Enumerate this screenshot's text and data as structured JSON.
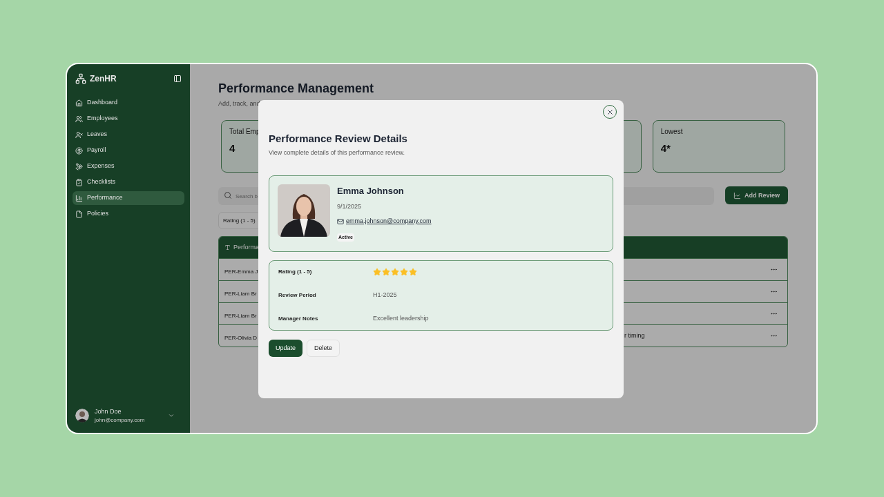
{
  "sidebar": {
    "brand": "ZenHR",
    "items": [
      {
        "label": "Dashboard",
        "selected": false
      },
      {
        "label": "Employees",
        "selected": false
      },
      {
        "label": "Leaves",
        "selected": false
      },
      {
        "label": "Payroll",
        "selected": false
      },
      {
        "label": "Expenses",
        "selected": false
      },
      {
        "label": "Checklists",
        "selected": false
      },
      {
        "label": "Performance",
        "selected": true
      },
      {
        "label": "Policies",
        "selected": false
      }
    ],
    "user": {
      "name": "John Doe",
      "email": "john@company.com"
    }
  },
  "page": {
    "title": "Performance Management",
    "subtitle": "Add, track, and",
    "stat_cards": [
      {
        "label": "Total Emp",
        "value": "4"
      },
      {
        "label": "Lowest",
        "value": "4*"
      }
    ],
    "search": {
      "placeholder": "Search b"
    },
    "add_button": "Add Review",
    "filter": "Rating (1 - 5)",
    "table": {
      "column_1": "Performa",
      "rows": [
        {
          "cell_1": "PER-Emma J"
        },
        {
          "cell_1": "PER-Liam Br"
        },
        {
          "cell_1": "PER-Liam Br"
        },
        {
          "cell_1": "PER-Olivia D",
          "cell_2": "r timing"
        }
      ]
    }
  },
  "modal": {
    "title": "Performance Review Details",
    "subtitle": "View complete details of this performance review.",
    "profile": {
      "name": "Emma Johnson",
      "date": "9/1/2025",
      "email": "emma.johnson@company.com",
      "status": "Active"
    },
    "details": [
      {
        "kind": "stars",
        "label": "Rating (1 - 5)",
        "stars": 5
      },
      {
        "kind": "text",
        "label": "Review Period",
        "value": "H1-2025"
      },
      {
        "kind": "text",
        "label": "Manager Notes",
        "value": "Excellent leadership"
      }
    ],
    "buttons": [
      {
        "label": "Update",
        "primary": true
      },
      {
        "label": "Delete",
        "primary": false
      }
    ]
  }
}
